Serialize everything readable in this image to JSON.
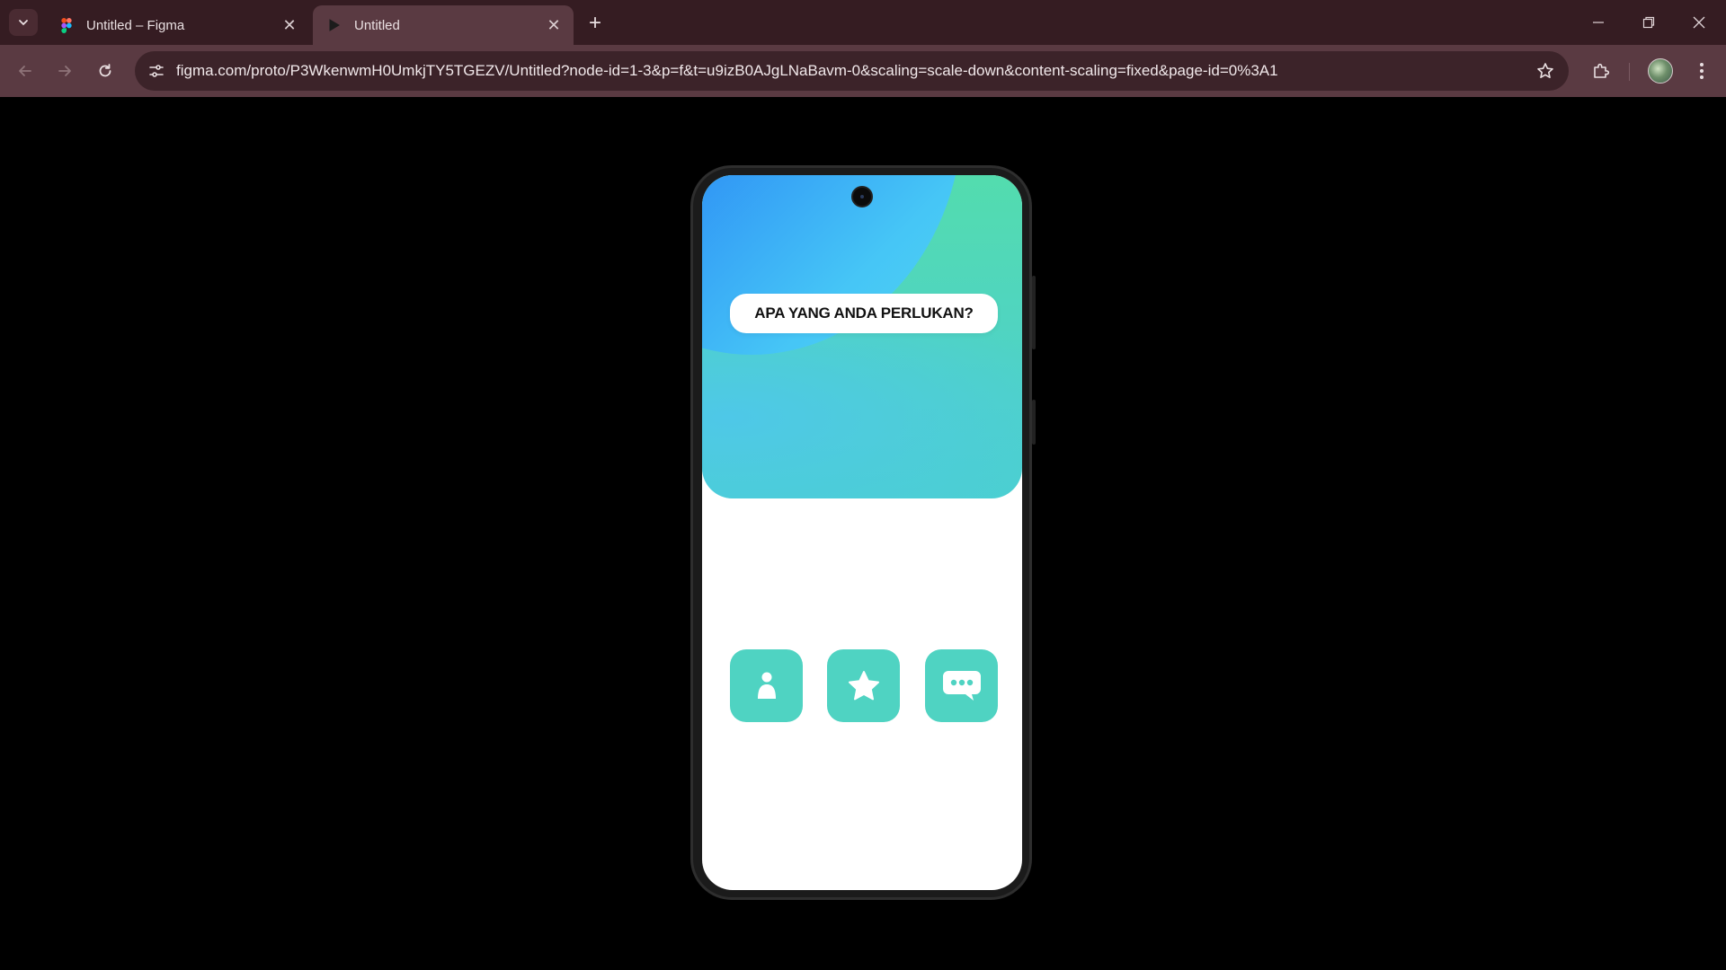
{
  "browser": {
    "tabs": [
      {
        "title": "Untitled – Figma",
        "favicon": "figma-icon",
        "active": false
      },
      {
        "title": "Untitled",
        "favicon": "play-icon",
        "active": true
      }
    ],
    "new_tab_label": "+",
    "url": "figma.com/proto/P3WkenwmH0UmkjTY5TGEZV/Untitled?node-id=1-3&p=f&t=u9izB0AJgLNaBavm-0&scaling=scale-down&content-scaling=fixed&page-id=0%3A1",
    "colors": {
      "frame": "#351c22",
      "toolbar": "#5a3a42",
      "omnibox": "#3c2329"
    }
  },
  "prototype": {
    "question": "APA YANG ANDA PERLUKAN?",
    "actions": [
      {
        "icon": "person-icon"
      },
      {
        "icon": "star-icon"
      },
      {
        "icon": "chat-icon"
      }
    ],
    "colors": {
      "accent": "#4fd3c2",
      "blue": "#1a72f2",
      "screen_bg": "#ffffff"
    }
  }
}
